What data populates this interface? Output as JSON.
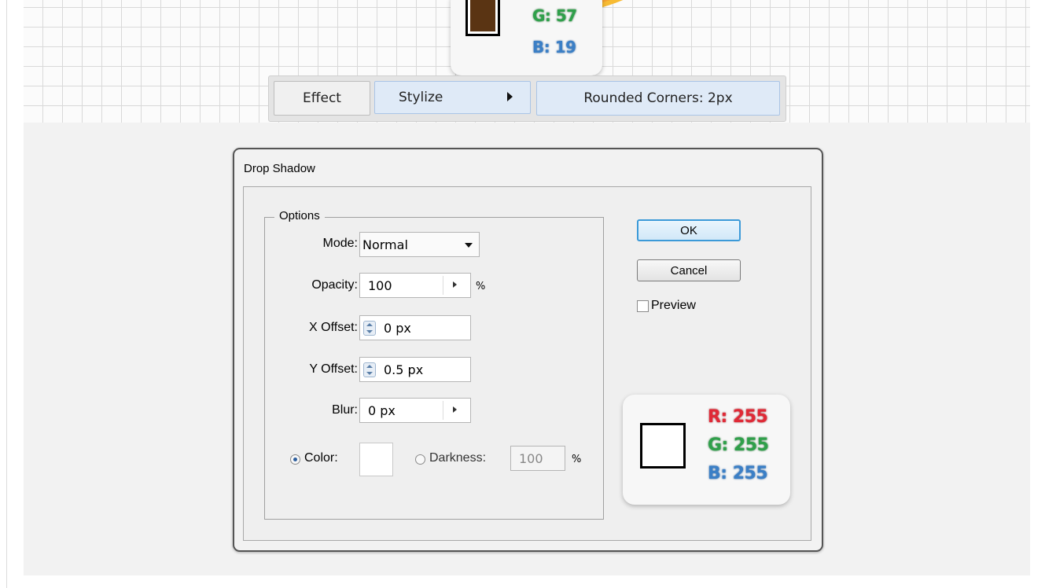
{
  "top_callout": {
    "g": "G: 57",
    "b": "B: 19",
    "swatch_color": "#5a3413"
  },
  "menu_path": {
    "effect": "Effect",
    "stylize": "Stylize",
    "rounded_corners": "Rounded Corners: 2px"
  },
  "dialog": {
    "title": "Drop Shadow",
    "options_legend": "Options",
    "mode": {
      "label": "Mode:",
      "value": "Normal"
    },
    "opacity": {
      "label": "Opacity:",
      "value": "100",
      "unit": "%"
    },
    "x_offset": {
      "label": "X Offset:",
      "value": "0 px"
    },
    "y_offset": {
      "label": "Y Offset:",
      "value": "0.5 px"
    },
    "blur": {
      "label": "Blur:",
      "value": "0 px"
    },
    "color": {
      "label": "Color:",
      "selected": true,
      "swatch": "#ffffff"
    },
    "darkness": {
      "label": "Darkness:",
      "value": "100",
      "unit": "%",
      "selected": false
    },
    "ok_label": "OK",
    "cancel_label": "Cancel",
    "preview_label": "Preview",
    "preview_checked": false
  },
  "color_callout": {
    "r": "R: 255",
    "g": "G: 255",
    "b": "B: 255",
    "swatch_color": "#ffffff"
  }
}
